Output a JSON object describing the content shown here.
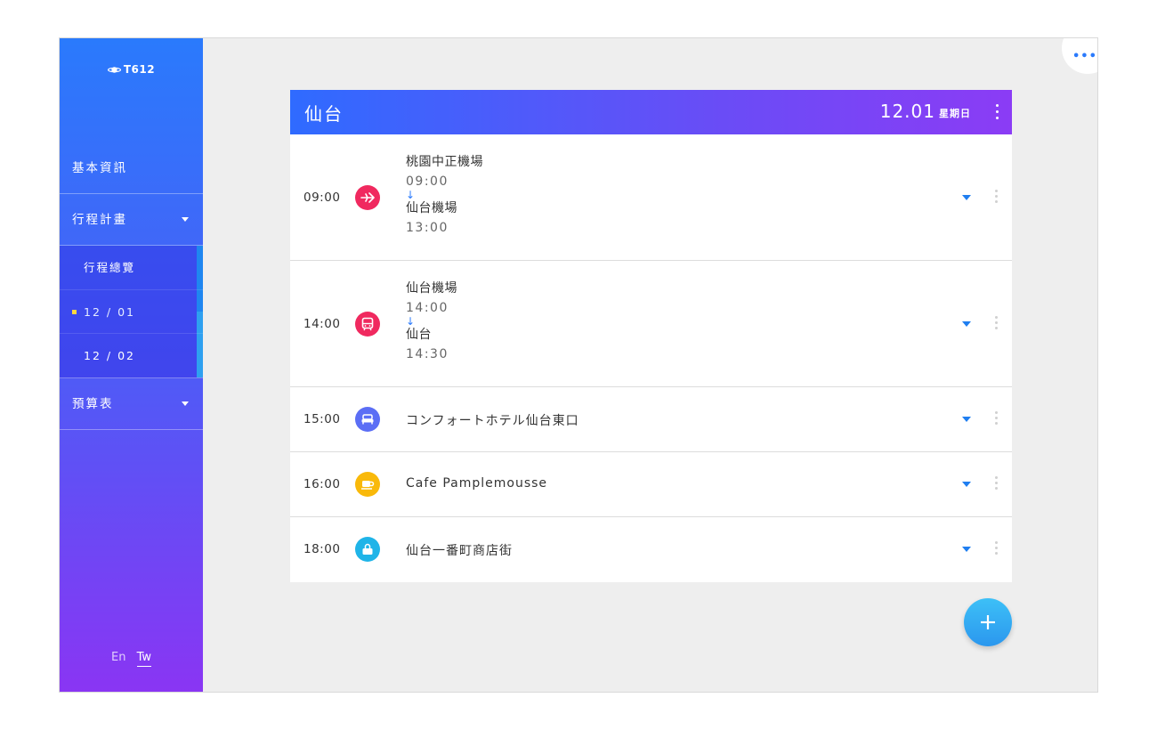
{
  "brand": {
    "name": "T612"
  },
  "sidebar": {
    "items": [
      {
        "label": "基本資訊"
      },
      {
        "label": "行程計畫"
      },
      {
        "label": "預算表"
      }
    ],
    "subitems": [
      {
        "label": "行程總覽"
      },
      {
        "label": "12 / 01"
      },
      {
        "label": "12 / 02"
      }
    ],
    "active_subitem": "12 / 01",
    "languages": [
      "En",
      "Tw"
    ],
    "active_language": "Tw"
  },
  "header": {
    "city": "仙台",
    "date": "12.01",
    "weekday": "星期日"
  },
  "schedule": [
    {
      "time": "09:00",
      "icon": "airplane-icon",
      "color": "#f0295f",
      "from_place": "桃園中正機場",
      "from_time": "09:00",
      "arrow": "↓",
      "to_place": "仙台機場",
      "to_time": "13:00"
    },
    {
      "time": "14:00",
      "icon": "bus-icon",
      "color": "#f0295f",
      "from_place": "仙台機場",
      "from_time": "14:00",
      "arrow": "↓",
      "to_place": "仙台",
      "to_time": "14:30"
    },
    {
      "time": "15:00",
      "icon": "hotel-bed-icon",
      "color": "#5b6ef5",
      "name": "コンフォートホテル仙台東口"
    },
    {
      "time": "16:00",
      "icon": "coffee-cup-icon",
      "color": "#f9b90a",
      "name": "Cafe Pamplemousse"
    },
    {
      "time": "18:00",
      "icon": "shopping-bag-icon",
      "color": "#1fb4e8",
      "name": "仙台一番町商店街"
    }
  ],
  "colors": {
    "accent": "#2a7afc",
    "sidebar_top": "#2a7afc",
    "sidebar_bottom": "#8a35f3",
    "active_marker": "#ffd740",
    "fab": "#2b97ee"
  }
}
